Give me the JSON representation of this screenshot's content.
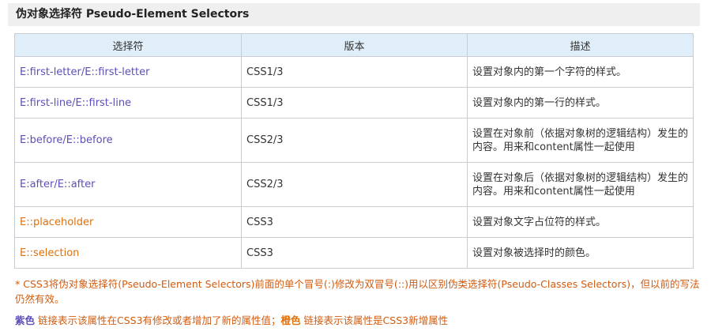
{
  "title": "伪对象选择符 Pseudo-Element Selectors",
  "table": {
    "headers": [
      "选择符",
      "版本",
      "描述"
    ],
    "rows": [
      {
        "selector": "E:first-letter/E::first-letter",
        "version": "CSS1/3",
        "description": "设置对象内的第一个字符的样式。",
        "kind": "purple"
      },
      {
        "selector": "E:first-line/E::first-line",
        "version": "CSS1/3",
        "description": "设置对象内的第一行的样式。",
        "kind": "purple"
      },
      {
        "selector": "E:before/E::before",
        "version": "CSS2/3",
        "description": "设置在对象前（依据对象树的逻辑结构）发生的内容。用来和content属性一起使用",
        "kind": "purple"
      },
      {
        "selector": "E:after/E::after",
        "version": "CSS2/3",
        "description": "设置在对象后（依据对象树的逻辑结构）发生的内容。用来和content属性一起使用",
        "kind": "purple"
      },
      {
        "selector": "E::placeholder",
        "version": "CSS3",
        "description": "设置对象文字占位符的样式。",
        "kind": "orange"
      },
      {
        "selector": "E::selection",
        "version": "CSS3",
        "description": "设置对象被选择时的颜色。",
        "kind": "orange"
      }
    ]
  },
  "note": "* CSS3将伪对象选择符(Pseudo-Element Selectors)前面的单个冒号(:)修改为双冒号(::)用以区别伪类选择符(Pseudo-Classes Selectors)，但以前的写法仍然有效。",
  "legend": {
    "purple_word": "紫色",
    "purple_text": " 链接表示该属性在CSS3有修改或者增加了新的属性值；",
    "orange_word": "橙色",
    "orange_text": " 链接表示该属性是CSS3新增属性"
  },
  "colors": {
    "purple": "#5b50b8",
    "orange": "#e0700e",
    "header_bg": "#dfeef9",
    "note": "#d15c10"
  }
}
